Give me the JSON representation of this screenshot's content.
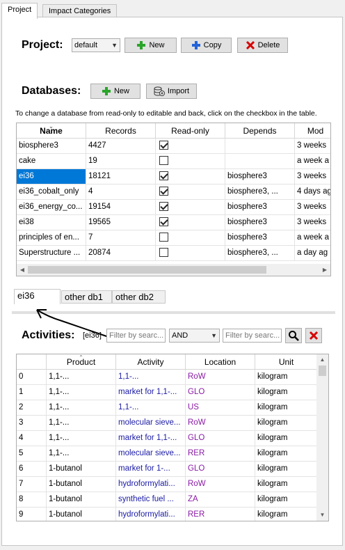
{
  "tabs": [
    {
      "label": "Project",
      "active": true
    },
    {
      "label": "Impact Categories",
      "active": false
    }
  ],
  "project": {
    "label": "Project:",
    "selected": "default",
    "new_label": "New",
    "copy_label": "Copy",
    "delete_label": "Delete"
  },
  "databases": {
    "label": "Databases:",
    "new_label": "New",
    "import_label": "Import",
    "hint": "To change a database from read-only to editable and back, click on the checkbox in the table.",
    "columns": [
      "Name",
      "Records",
      "Read-only",
      "Depends",
      "Mod"
    ],
    "rows": [
      {
        "name": "biosphere3",
        "records": "4427",
        "readonly": true,
        "depends": "",
        "modified": "3 weeks"
      },
      {
        "name": "cake",
        "records": "19",
        "readonly": false,
        "depends": "",
        "modified": "a week a"
      },
      {
        "name": "ei36",
        "records": "18121",
        "readonly": true,
        "depends": "biosphere3",
        "modified": "3 weeks"
      },
      {
        "name": "ei36_cobalt_only",
        "records": "4",
        "readonly": true,
        "depends": "biosphere3, ...",
        "modified": "4 days ag"
      },
      {
        "name": "ei36_energy_co...",
        "records": "19154",
        "readonly": true,
        "depends": "biosphere3",
        "modified": "3 weeks"
      },
      {
        "name": "ei38",
        "records": "19565",
        "readonly": true,
        "depends": "biosphere3",
        "modified": "3 weeks"
      },
      {
        "name": "principles of en...",
        "records": "7",
        "readonly": false,
        "depends": "biosphere3",
        "modified": "a week a"
      },
      {
        "name": "Superstructure ...",
        "records": "20874",
        "readonly": false,
        "depends": "biosphere3, ...",
        "modified": "a day ag"
      }
    ]
  },
  "db_tabs": [
    {
      "label": "ei36",
      "active": true
    },
    {
      "label": "other db1",
      "active": false
    },
    {
      "label": "other db2",
      "active": false
    }
  ],
  "activities": {
    "label": "Activities:",
    "db_tag": "[ei36]",
    "filter_placeholder_1": "Filter by searc...",
    "operator": "AND",
    "filter_placeholder_2": "Filter by searc...",
    "columns": [
      "",
      "Product",
      "Activity",
      "Location",
      "Unit"
    ],
    "rows": [
      {
        "idx": "0",
        "product": "1,1-...",
        "activity": "1,1-...",
        "location": "RoW",
        "unit": "kilogram"
      },
      {
        "idx": "1",
        "product": "1,1-...",
        "activity": "market for 1,1-...",
        "location": "GLO",
        "unit": "kilogram"
      },
      {
        "idx": "2",
        "product": "1,1-...",
        "activity": "1,1-...",
        "location": "US",
        "unit": "kilogram"
      },
      {
        "idx": "3",
        "product": "1,1-...",
        "activity": "molecular sieve...",
        "location": "RoW",
        "unit": "kilogram"
      },
      {
        "idx": "4",
        "product": "1,1-...",
        "activity": "market for 1,1-...",
        "location": "GLO",
        "unit": "kilogram"
      },
      {
        "idx": "5",
        "product": "1,1-...",
        "activity": "molecular sieve...",
        "location": "RER",
        "unit": "kilogram"
      },
      {
        "idx": "6",
        "product": "1-butanol",
        "activity": "market for 1-...",
        "location": "GLO",
        "unit": "kilogram"
      },
      {
        "idx": "7",
        "product": "1-butanol",
        "activity": "hydroformylati...",
        "location": "RoW",
        "unit": "kilogram"
      },
      {
        "idx": "8",
        "product": "1-butanol",
        "activity": "synthetic fuel ...",
        "location": "ZA",
        "unit": "kilogram"
      },
      {
        "idx": "9",
        "product": "1-butanol",
        "activity": "hydroformylati...",
        "location": "RER",
        "unit": "kilogram"
      }
    ]
  },
  "colors": {
    "selection": "#0078d7",
    "activity_text": "#1a1aa6",
    "location_text": "#8a1aa6",
    "delete_red": "#d60000",
    "add_green": "#2aa52a",
    "copy_blue": "#2464d8"
  }
}
